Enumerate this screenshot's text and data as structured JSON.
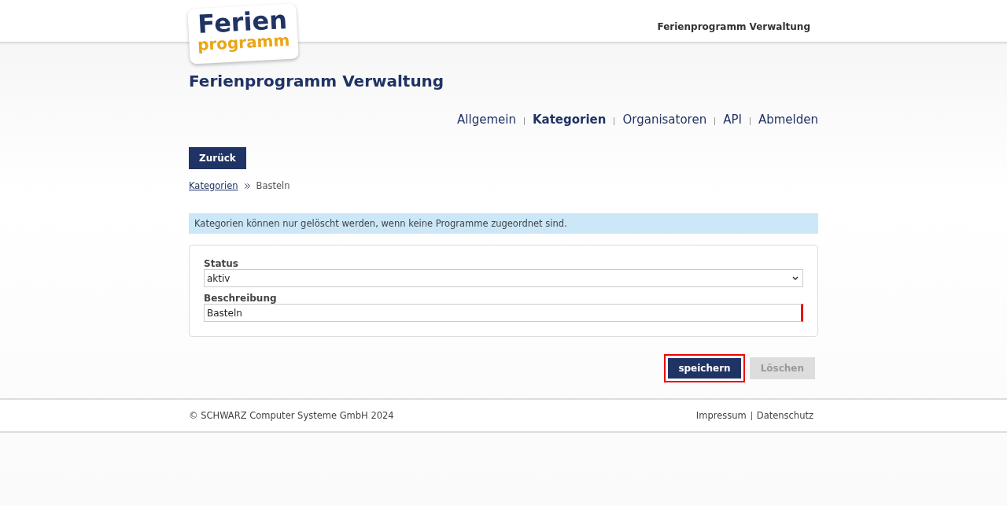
{
  "header": {
    "logo": {
      "line_1": "Ferien",
      "line_2": "programm"
    },
    "title": "Ferienprogramm Verwaltung"
  },
  "page_title": "Ferienprogramm Verwaltung",
  "nav": [
    {
      "label": "Allgemein",
      "selected": false
    },
    {
      "label": "Kategorien",
      "selected": true
    },
    {
      "label": "Organisatoren",
      "selected": false
    },
    {
      "label": "API",
      "selected": false
    },
    {
      "label": "Abmelden",
      "selected": false
    }
  ],
  "back_button": "Zurück",
  "breadcrumb": [
    {
      "label": "Kategorien",
      "link": true
    },
    {
      "label": "Basteln",
      "link": false
    }
  ],
  "info": "Kategorien können nur gelöscht werden, wenn keine Programme zugeordnet sind.",
  "form": {
    "fields": [
      {
        "kind": "select",
        "label": "Status",
        "value": "aktiv",
        "required": false
      },
      {
        "kind": "text",
        "label": "Beschreibung",
        "value": "Basteln",
        "required": true
      }
    ]
  },
  "buttons": [
    {
      "label": "speichern",
      "disabled": false,
      "focused": true
    },
    {
      "label": "Löschen",
      "disabled": true,
      "focused": false
    }
  ],
  "footer": {
    "copyright": "© SCHWARZ Computer Systeme GmbH 2024",
    "links": [
      "Impressum",
      "Datenschutz"
    ]
  }
}
